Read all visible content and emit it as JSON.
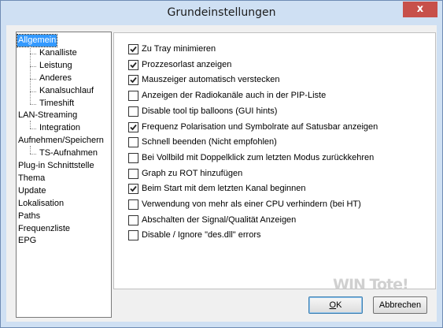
{
  "window": {
    "title": "Grundeinstellungen",
    "close_glyph": "x"
  },
  "tree": {
    "items": [
      {
        "label": "Allgemein",
        "level": 0,
        "selected": true
      },
      {
        "label": "Kanalliste",
        "level": 1
      },
      {
        "label": "Leistung",
        "level": 1
      },
      {
        "label": "Anderes",
        "level": 1
      },
      {
        "label": "Kanalsuchlauf",
        "level": 1
      },
      {
        "label": "Timeshift",
        "level": 1
      },
      {
        "label": "LAN-Streaming",
        "level": 0
      },
      {
        "label": "Integration",
        "level": 1
      },
      {
        "label": "Aufnehmen/Speichern",
        "level": 0
      },
      {
        "label": "TS-Aufnahmen",
        "level": 1
      },
      {
        "label": "Plug-in Schnittstelle",
        "level": 0
      },
      {
        "label": "Thema",
        "level": 0
      },
      {
        "label": "Update",
        "level": 0
      },
      {
        "label": "Lokalisation",
        "level": 0
      },
      {
        "label": "Paths",
        "level": 0
      },
      {
        "label": "Frequenzliste",
        "level": 0
      },
      {
        "label": "EPG",
        "level": 0
      }
    ]
  },
  "options": [
    {
      "label": "Zu Tray minimieren",
      "checked": true
    },
    {
      "label": "Prozzesorlast anzeigen",
      "checked": true
    },
    {
      "label": "Mauszeiger automatisch verstecken",
      "checked": true
    },
    {
      "label": "Anzeigen der Radiokanäle auch in der PIP-Liste",
      "checked": false
    },
    {
      "label": "Disable tool tip balloons (GUI hints)",
      "checked": false
    },
    {
      "label": "Frequenz Polarisation und Symbolrate auf Satusbar anzeigen",
      "checked": true
    },
    {
      "label": "Schnell beenden (Nicht empfohlen)",
      "checked": false
    },
    {
      "label": "Bei Vollbild mit Doppelklick zum letzten Modus zurückkehren",
      "checked": false
    },
    {
      "label": "Graph zu ROT hinzufügen",
      "checked": false
    },
    {
      "label": "Beim Start mit dem letzten Kanal beginnen",
      "checked": true
    },
    {
      "label": "Verwendung von mehr als einer CPU verhindern (bei HT)",
      "checked": false
    },
    {
      "label": "Abschalten der Signal/Qualität Anzeigen",
      "checked": false
    },
    {
      "label": "Disable / Ignore \"des.dll\" errors",
      "checked": false
    }
  ],
  "buttons": {
    "ok_mnemonic": "O",
    "ok_rest": "K",
    "cancel_label": "Abbrechen"
  },
  "watermark": "WIN Tote!"
}
